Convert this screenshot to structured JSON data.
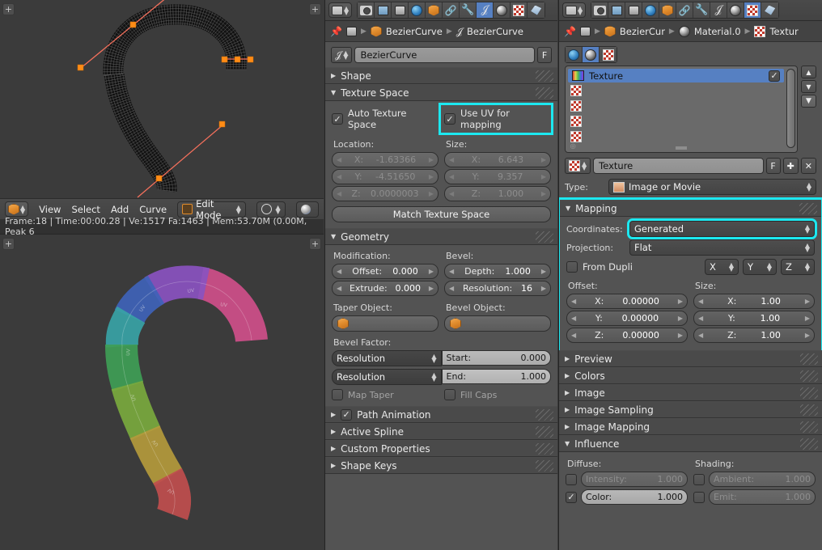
{
  "viewport_top": {
    "name": "3d-viewport-wireframe",
    "plus_left": "+",
    "plus_right": "+"
  },
  "viewport_header": {
    "editor_icon": "object-mode-icon",
    "menus": [
      "View",
      "Select",
      "Add",
      "Curve"
    ],
    "mode": "Edit Mode",
    "pivot_icon": "pivot-icon",
    "snap_icon": "snap-icon"
  },
  "status_bar": {
    "text": "Frame:18 | Time:00:00.28 | Ve:1517 Fa:1463 | Mem:53.70M (0.00M, Peak 6"
  },
  "viewport_bottom": {
    "name": "3d-viewport-textured",
    "plus_left": "+",
    "plus_right": "+"
  },
  "properties_curve": {
    "editor_type_icon": "properties-editor-icon",
    "tabs": [
      {
        "name": "render",
        "icon": "camera-icon",
        "active": false
      },
      {
        "name": "render-layers",
        "icon": "images-icon",
        "active": false
      },
      {
        "name": "scene",
        "icon": "scene-icon",
        "active": false
      },
      {
        "name": "world",
        "icon": "globe-icon",
        "active": false
      },
      {
        "name": "object",
        "icon": "cube-icon",
        "active": false
      },
      {
        "name": "constraints",
        "icon": "link-icon",
        "active": false
      },
      {
        "name": "modifiers",
        "icon": "wrench-icon",
        "active": false
      },
      {
        "name": "object-data",
        "icon": "curve-data-icon",
        "active": true
      },
      {
        "name": "material",
        "icon": "material-icon",
        "active": false
      },
      {
        "name": "texture",
        "icon": "checker-icon",
        "active": false
      },
      {
        "name": "physics",
        "icon": "physics-icon",
        "active": false
      }
    ],
    "breadcrumb": [
      {
        "icon": "pin-icon",
        "label": ""
      },
      {
        "icon": "scene-icon",
        "label": ""
      },
      {
        "icon": "cube-icon",
        "label": "BezierCurve"
      },
      {
        "icon": "curve-data-icon",
        "label": "BezierCurve"
      }
    ],
    "datablock": {
      "icon": "curve-data-icon",
      "name": "BezierCurve",
      "fake_user_label": "F"
    },
    "panels": {
      "shape": {
        "label": "Shape",
        "open": false
      },
      "texture_space": {
        "label": "Texture Space",
        "open": true,
        "auto_texture_space": {
          "label": "Auto Texture Space",
          "checked": true
        },
        "use_uv_for_mapping": {
          "label": "Use UV for mapping",
          "checked": true,
          "highlighted": true
        },
        "location_label": "Location:",
        "size_label": "Size:",
        "location": [
          {
            "key": "X:",
            "value": "-1.63366"
          },
          {
            "key": "Y:",
            "value": "-4.51650"
          },
          {
            "key": "Z:",
            "value": "0.0000003"
          }
        ],
        "size": [
          {
            "key": "X:",
            "value": "6.643"
          },
          {
            "key": "Y:",
            "value": "9.357"
          },
          {
            "key": "Z:",
            "value": "1.000"
          }
        ],
        "match_button": "Match Texture Space"
      },
      "geometry": {
        "label": "Geometry",
        "open": true,
        "modification_label": "Modification:",
        "bevel_label": "Bevel:",
        "offset": {
          "key": "Offset:",
          "value": "0.000"
        },
        "extrude": {
          "key": "Extrude:",
          "value": "0.000"
        },
        "depth": {
          "key": "Depth:",
          "value": "1.000"
        },
        "bevel_resolution": {
          "key": "Resolution:",
          "value": "16"
        },
        "taper_object_label": "Taper Object:",
        "bevel_object_label": "Bevel Object:",
        "taper_object_value": "",
        "bevel_object_value": "",
        "bevel_factor_label": "Bevel Factor:",
        "start_mode": "Resolution",
        "end_mode": "Resolution",
        "start": {
          "key": "Start:",
          "value": "0.000"
        },
        "end": {
          "key": "End:",
          "value": "1.000"
        },
        "map_taper": {
          "label": "Map Taper",
          "checked": false
        },
        "fill_caps": {
          "label": "Fill Caps",
          "checked": false
        }
      },
      "path_animation": {
        "label": "Path Animation",
        "open": false,
        "checked": true
      },
      "active_spline": {
        "label": "Active Spline",
        "open": false
      },
      "custom_properties": {
        "label": "Custom Properties",
        "open": false
      },
      "shape_keys": {
        "label": "Shape Keys",
        "open": false
      }
    }
  },
  "properties_texture": {
    "editor_type_icon": "properties-editor-icon",
    "tabs": [
      {
        "name": "render",
        "icon": "camera-icon",
        "active": false
      },
      {
        "name": "render-layers",
        "icon": "images-icon",
        "active": false
      },
      {
        "name": "scene",
        "icon": "scene-icon",
        "active": false
      },
      {
        "name": "world",
        "icon": "globe-icon",
        "active": false
      },
      {
        "name": "object",
        "icon": "cube-icon",
        "active": false
      },
      {
        "name": "constraints",
        "icon": "link-icon",
        "active": false
      },
      {
        "name": "modifiers",
        "icon": "wrench-icon",
        "active": false
      },
      {
        "name": "object-data",
        "icon": "curve-data-icon",
        "active": false
      },
      {
        "name": "material",
        "icon": "material-icon",
        "active": false
      },
      {
        "name": "texture",
        "icon": "checker-icon",
        "active": true
      },
      {
        "name": "physics",
        "icon": "physics-icon",
        "active": false
      }
    ],
    "breadcrumb": [
      {
        "icon": "pin-icon",
        "label": ""
      },
      {
        "icon": "scene-icon",
        "label": ""
      },
      {
        "icon": "cube-icon",
        "label": "BezierCur"
      },
      {
        "icon": "material-icon",
        "label": "Material.0"
      },
      {
        "icon": "checker-icon",
        "label": "Textur"
      }
    ],
    "context_buttons": [
      {
        "name": "world-texture-context",
        "icon": "globe-icon",
        "active": false
      },
      {
        "name": "material-texture-context",
        "icon": "material-icon",
        "active": true
      },
      {
        "name": "texture-context",
        "icon": "checker-icon",
        "active": false
      }
    ],
    "slot_list": {
      "items": [
        {
          "icon": "color-ramp-icon",
          "label": "Texture",
          "selected": true,
          "enabled": true
        },
        {
          "icon": "checker-icon",
          "label": "",
          "selected": false,
          "enabled": false
        },
        {
          "icon": "checker-icon",
          "label": "",
          "selected": false,
          "enabled": false
        },
        {
          "icon": "checker-icon",
          "label": "",
          "selected": false,
          "enabled": false
        },
        {
          "icon": "checker-icon",
          "label": "",
          "selected": false,
          "enabled": false
        }
      ],
      "add_icon": "add-slot-icon",
      "nav_up": "▲",
      "nav_down": "▼",
      "nav_menu": "▼"
    },
    "datablock": {
      "icon": "checker-icon",
      "name": "Texture",
      "fake_user_label": "F",
      "new_label": "✚",
      "unlink_label": "✕"
    },
    "type_row": {
      "label": "Type:",
      "icon": "image-movie-icon",
      "value": "Image or Movie"
    },
    "mapping": {
      "label": "Mapping",
      "open": true,
      "highlighted": true,
      "coordinates_label": "Coordinates:",
      "coordinates_value": "Generated",
      "coordinates_highlighted": true,
      "projection_label": "Projection:",
      "projection_value": "Flat",
      "from_dupli": {
        "label": "From Dupli",
        "checked": false
      },
      "axis": [
        "X",
        "Y",
        "Z"
      ],
      "offset_label": "Offset:",
      "size_label": "Size:",
      "offset": [
        {
          "key": "X:",
          "value": "0.00000"
        },
        {
          "key": "Y:",
          "value": "0.00000"
        },
        {
          "key": "Z:",
          "value": "0.00000"
        }
      ],
      "size": [
        {
          "key": "X:",
          "value": "1.00"
        },
        {
          "key": "Y:",
          "value": "1.00"
        },
        {
          "key": "Z:",
          "value": "1.00"
        }
      ]
    },
    "collapsed_panels": [
      {
        "label": "Preview"
      },
      {
        "label": "Colors"
      },
      {
        "label": "Image"
      },
      {
        "label": "Image Sampling"
      },
      {
        "label": "Image Mapping"
      }
    ],
    "influence": {
      "label": "Influence",
      "open": true,
      "diffuse_label": "Diffuse:",
      "shading_label": "Shading:",
      "rows": [
        {
          "left": {
            "key": "Intensity:",
            "value": "1.000",
            "checked": false
          },
          "right": {
            "key": "Ambient:",
            "value": "1.000",
            "checked": false
          }
        },
        {
          "left": {
            "key": "Color:",
            "value": "1.000",
            "checked": true
          },
          "right": {
            "key": "Emit:",
            "value": "1.000",
            "checked": false
          }
        }
      ]
    }
  },
  "colors": {
    "highlight": "#1ce8f0",
    "accent_blue": "#5680c2",
    "panel_bg": "#535353",
    "header_bg": "#4a4a4a",
    "viewport_bg": "#3b3b3b",
    "curve_handle": "#ff6b4a",
    "curve_point": "#ff8a1e"
  }
}
